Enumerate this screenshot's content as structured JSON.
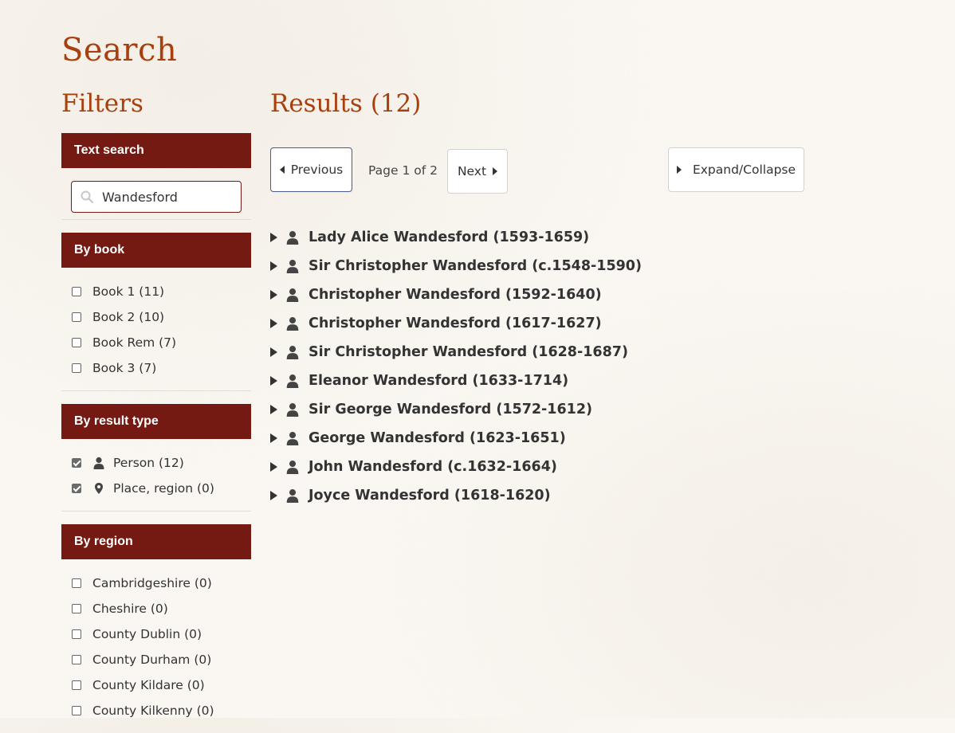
{
  "page": {
    "title": "Search"
  },
  "filters": {
    "title": "Filters",
    "text_search": {
      "header": "Text search",
      "value": "Wandesford"
    },
    "by_book": {
      "header": "By book",
      "items": [
        {
          "label": "Book 1 (11)",
          "checked": false
        },
        {
          "label": "Book 2 (10)",
          "checked": false
        },
        {
          "label": "Book Rem (7)",
          "checked": false
        },
        {
          "label": "Book 3 (7)",
          "checked": false
        }
      ]
    },
    "by_result_type": {
      "header": "By result type",
      "items": [
        {
          "label": "Person (12)",
          "checked": true,
          "icon": "person-icon"
        },
        {
          "label": "Place, region (0)",
          "checked": true,
          "icon": "map-marker-icon"
        }
      ]
    },
    "by_region": {
      "header": "By region",
      "items": [
        {
          "label": "Cambridgeshire (0)",
          "checked": false
        },
        {
          "label": "Cheshire (0)",
          "checked": false
        },
        {
          "label": "County Dublin (0)",
          "checked": false
        },
        {
          "label": "County Durham (0)",
          "checked": false
        },
        {
          "label": "County Kildare (0)",
          "checked": false
        },
        {
          "label": "County Kilkenny (0)",
          "checked": false
        }
      ]
    }
  },
  "results": {
    "title": "Results (12)",
    "pager": {
      "previous": "Previous",
      "page_info": "Page 1 of 2",
      "next": "Next",
      "expand": "Expand/Collapse"
    },
    "items": [
      "Lady Alice Wandesford (1593-1659)",
      "Sir Christopher Wandesford (c.1548-1590)",
      "Christopher Wandesford (1592-1640)",
      "Christopher Wandesford (1617-1627)",
      "Sir Christopher Wandesford (1628-1687)",
      "Eleanor Wandesford (1633-1714)",
      "Sir George Wandesford (1572-1612)",
      "George Wandesford (1623-1651)",
      "John Wandesford (c.1632-1664)",
      "Joyce Wandesford (1618-1620)"
    ]
  },
  "colors": {
    "accent": "#a8400e",
    "header_bg": "#751a12",
    "background": "#faf7f2"
  }
}
